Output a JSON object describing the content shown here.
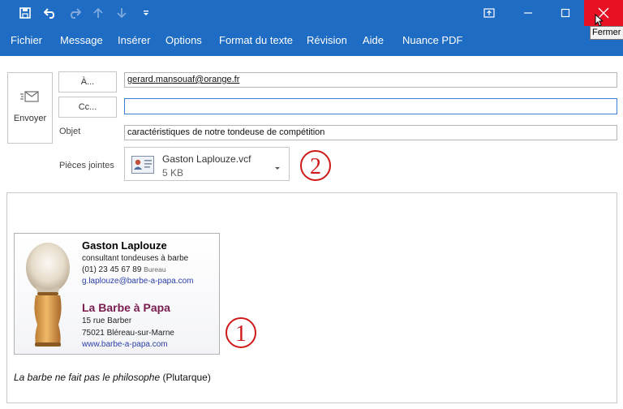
{
  "window": {
    "tooltip_close": "Fermer"
  },
  "ribbon": {
    "tabs": [
      "Fichier",
      "Message",
      "Insérer",
      "Options",
      "Format du texte",
      "Révision",
      "Aide",
      "Nuance PDF"
    ]
  },
  "compose": {
    "send_label": "Envoyer",
    "to_label": "À...",
    "cc_label": "Cc...",
    "subject_label": "Objet",
    "attachments_label": "Pièces jointes",
    "to_value": "gerard.mansouaf@orange.fr",
    "cc_value": "",
    "subject_value": "caractéristiques de notre tondeuse de compétition"
  },
  "attachment": {
    "name": "Gaston Laplouze.vcf",
    "size": "5 KB"
  },
  "callouts": {
    "one": "1",
    "two": "2"
  },
  "business_card": {
    "name": "Gaston Laplouze",
    "title": "consultant tondeuses à barbe",
    "phone": "(01) 23 45 67 89",
    "phone_type": "Bureau",
    "email": "g.laplouze@barbe-a-papa.com",
    "company": "La Barbe à Papa",
    "street": "15 rue Barber",
    "city": "75021 Bléreau-sur-Marne",
    "website": "www.barbe-a-papa.com"
  },
  "message": {
    "quote_italic": "La barbe ne fait pas le philosophe",
    "quote_author": " (Plutarque)"
  },
  "colors": {
    "titlebar": "#1e6cc4",
    "close_red": "#e81123",
    "company": "#7a1c4e",
    "link": "#2a3ea8",
    "callout": "#d01919"
  }
}
